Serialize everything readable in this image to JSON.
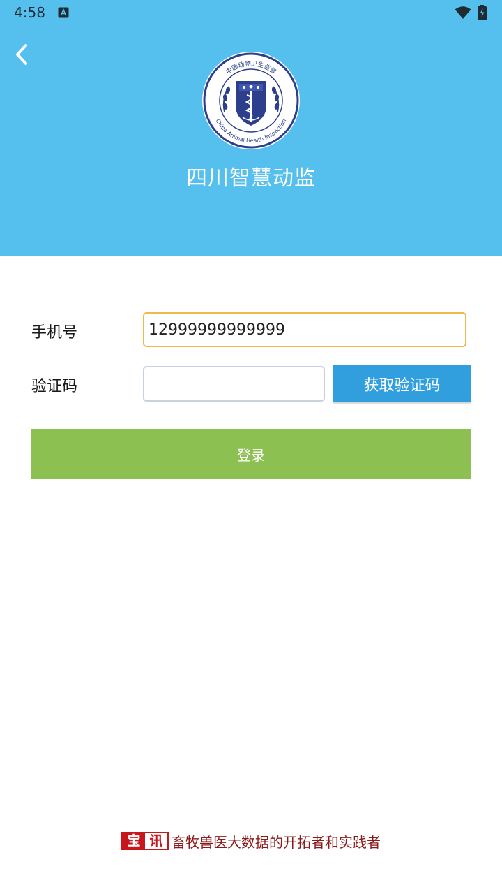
{
  "status_bar": {
    "time": "4:58"
  },
  "header": {
    "title": "四川智慧动监",
    "background_color": "#55C0EE",
    "logo": {
      "ring_text_top": "中国动物卫生监督",
      "ring_text_bottom": "China Animal Health Inspection"
    }
  },
  "form": {
    "phone_label": "手机号",
    "phone_value": "12999999999999",
    "code_label": "验证码",
    "code_value": "",
    "get_code_label": "获取验证码",
    "login_label": "登录"
  },
  "footer": {
    "brand_char_1": "宝",
    "brand_char_2": "讯",
    "slogan": "畜牧兽医大数据的开拓者和实践者"
  },
  "colors": {
    "header": "#55C0EE",
    "get_code_button": "#319FDE",
    "login_button": "#8CC152",
    "phone_focus_border": "#F0B94A",
    "brand_red": "#C8161D"
  },
  "icons": {
    "back": "chevron-left-icon",
    "wifi": "wifi-icon",
    "battery": "battery-charging-icon",
    "notification": "a-notification-icon"
  }
}
